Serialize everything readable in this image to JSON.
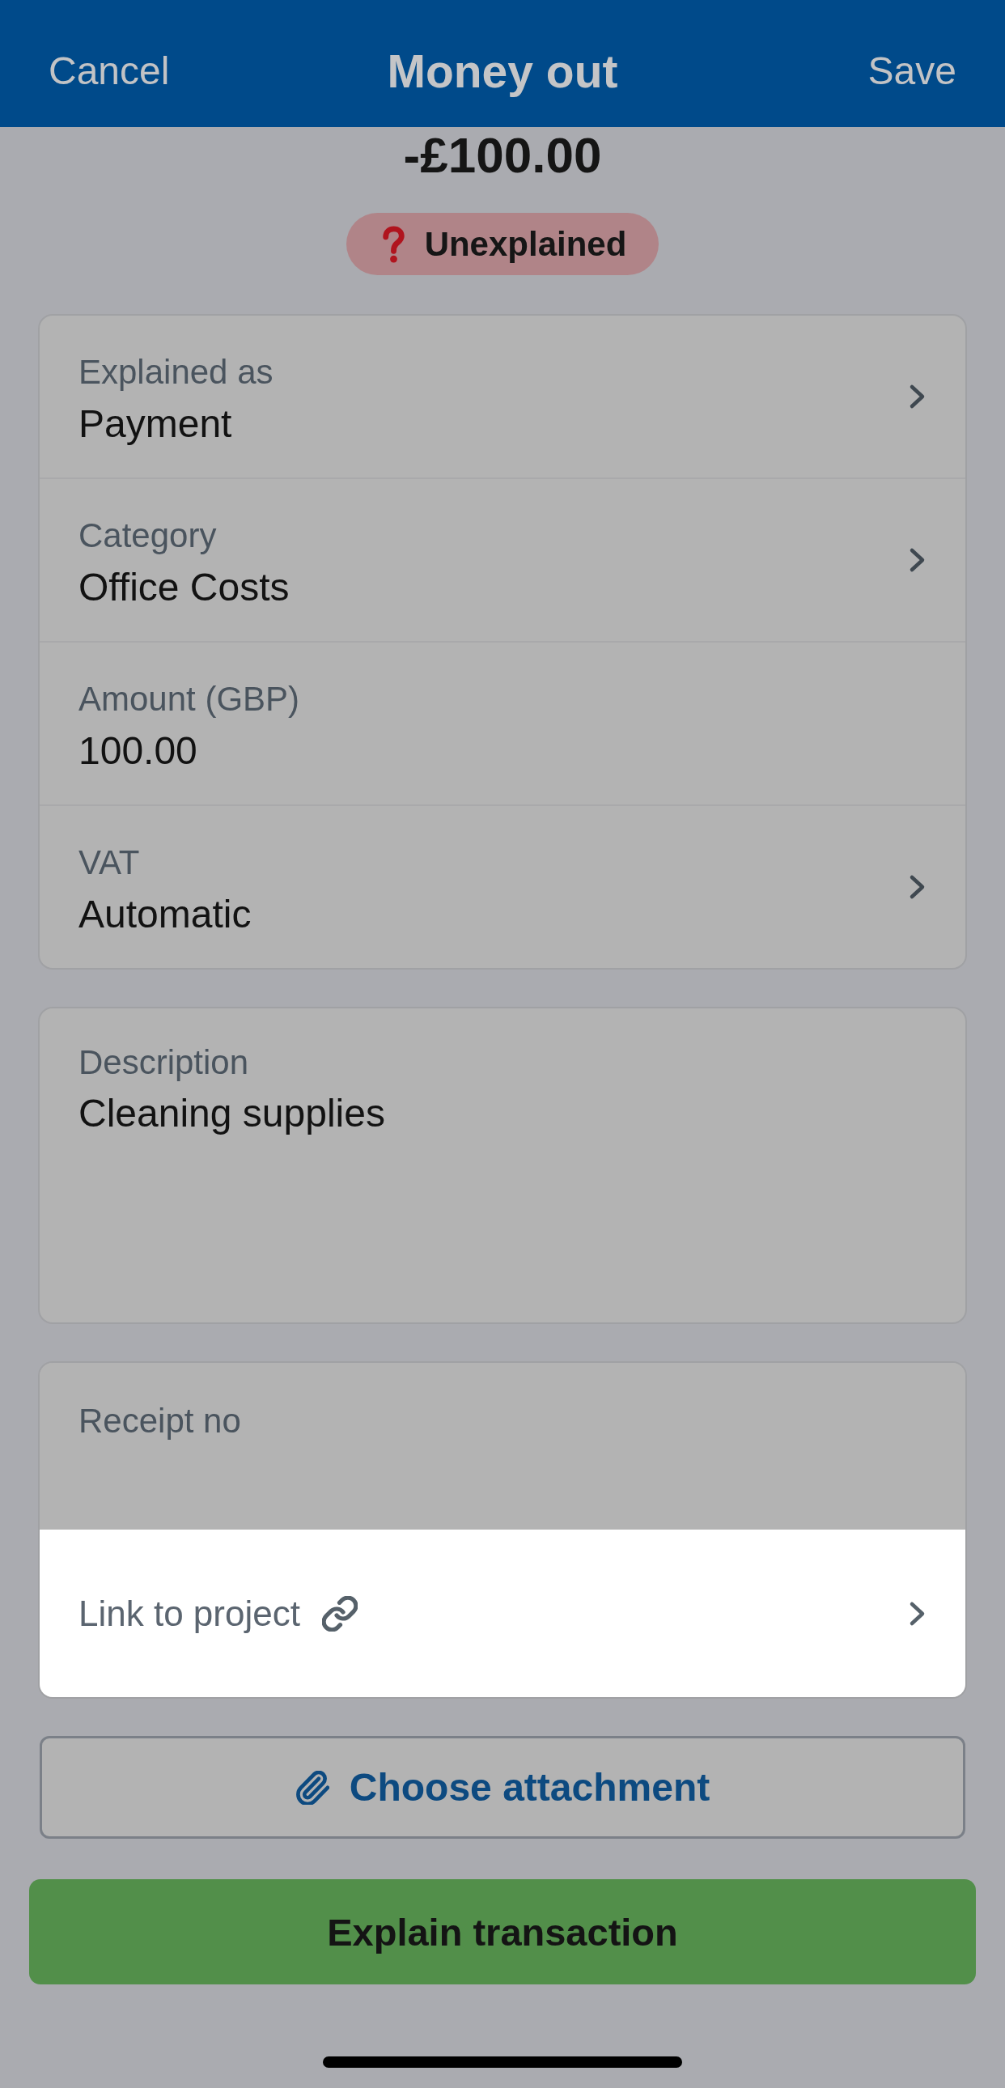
{
  "header": {
    "cancel": "Cancel",
    "title": "Money out",
    "save": "Save"
  },
  "transaction": {
    "amount": "-£100.00",
    "status": {
      "label": "Unexplained"
    }
  },
  "details": [
    {
      "label": "Explained as",
      "value": "Payment",
      "kind": "select"
    },
    {
      "label": "Category",
      "value": "Office Costs",
      "kind": "select"
    },
    {
      "label": "Amount (GBP)",
      "value": "100.00",
      "kind": "input"
    },
    {
      "label": "VAT",
      "value": "Automatic",
      "kind": "select"
    }
  ],
  "description": {
    "label": "Description",
    "value": "Cleaning supplies"
  },
  "extras": [
    {
      "kind": "input",
      "label": "Receipt no",
      "highlighted": false
    },
    {
      "kind": "link",
      "label": "Link to project",
      "highlighted": true
    }
  ],
  "attachment_button": "Choose attachment",
  "explain_button": "Explain transaction"
}
